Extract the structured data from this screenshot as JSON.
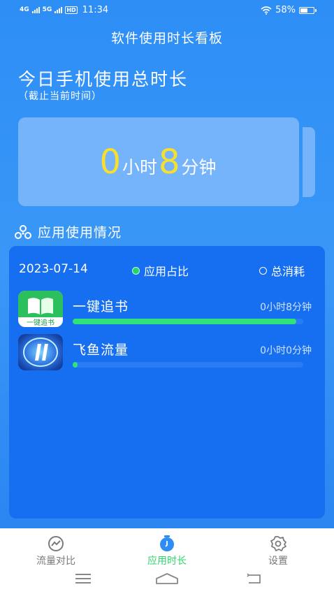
{
  "status_bar": {
    "signal1": "4G",
    "signal2": "5G",
    "hd": "HD",
    "time": "11:34",
    "battery_percent": "58%",
    "battery_level": 0.58
  },
  "app_title": "软件使用时长看板",
  "today": {
    "title": "今日手机使用总时长",
    "subtitle": "（截止当前时间）",
    "hours": "0",
    "hours_unit": "小时",
    "minutes": "8",
    "minutes_unit": "分钟"
  },
  "section": {
    "title": "应用使用情况"
  },
  "panel": {
    "date": "2023-07-14",
    "legend_ratio": "应用占比",
    "legend_total": "总消耗",
    "apps": [
      {
        "name": "一键追书",
        "time": "0小时8分钟",
        "progress": 0.97,
        "icon": "book-app-icon",
        "icon_text": "一键追书"
      },
      {
        "name": "飞鱼流量",
        "time": "0小时0分钟",
        "progress": 0.02,
        "icon": "feiyu-app-icon"
      }
    ]
  },
  "bottom_nav": {
    "items": [
      {
        "label": "流量对比",
        "icon": "trend-icon"
      },
      {
        "label": "应用时长",
        "icon": "timer-icon",
        "active": true
      },
      {
        "label": "设置",
        "icon": "gear-icon"
      }
    ]
  },
  "colors": {
    "accent_yellow": "#f7df2b",
    "accent_green": "#2fd36e",
    "panel_blue": "#166ff0"
  }
}
